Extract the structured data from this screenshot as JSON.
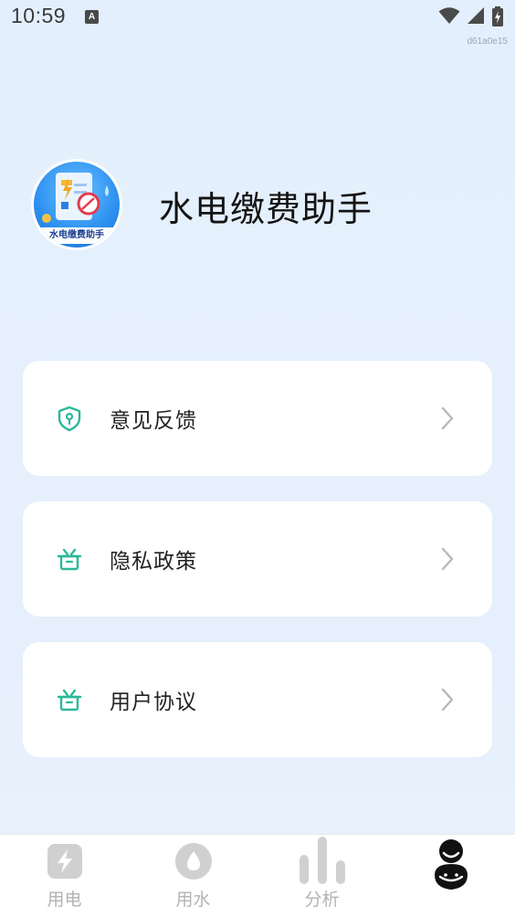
{
  "status_bar": {
    "time": "10:59",
    "notification_icon": "a-letter-icon",
    "notification_glyph": "A",
    "icons": [
      "wifi-icon",
      "signal-icon",
      "battery-icon"
    ]
  },
  "build_id": "d61a0e15",
  "profile": {
    "avatar_caption": "水电缴费助手",
    "app_name": "水电缴费助手"
  },
  "menu": [
    {
      "label": "意见反馈",
      "icon": "shield-icon"
    },
    {
      "label": "隐私政策",
      "icon": "gift-box-icon"
    },
    {
      "label": "用户协议",
      "icon": "gift-box-icon"
    }
  ],
  "tabs": [
    {
      "label": "用电",
      "icon": "electricity-icon"
    },
    {
      "label": "用水",
      "icon": "water-drop-icon"
    },
    {
      "label": "分析",
      "icon": "bar-chart-icon"
    },
    {
      "label": "",
      "icon": "profile-icon"
    }
  ],
  "colors": {
    "accent": "#2bb89a",
    "background": "#e6f0fc",
    "card": "#ffffff",
    "tab_inactive": "#b3b3b3"
  }
}
